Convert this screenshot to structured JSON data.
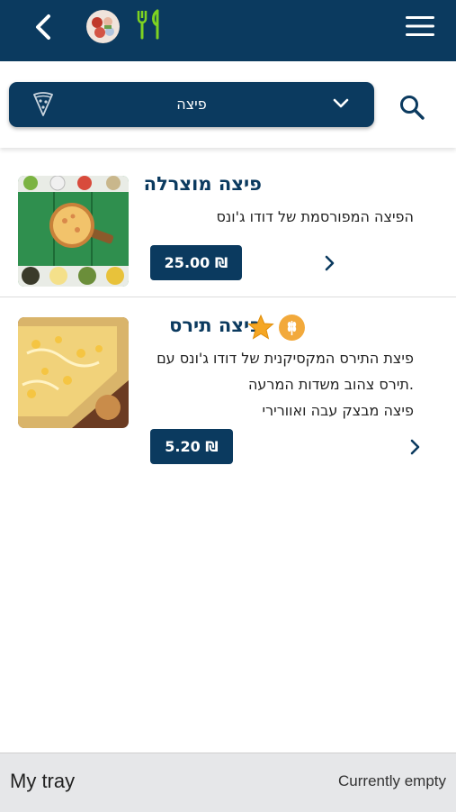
{
  "colors": {
    "brand": "#0b3a5f",
    "accent_green": "#7ed321",
    "badge_orange": "#f2a93b",
    "star": "#f5a623"
  },
  "header": {
    "back_icon": "chevron-left-icon",
    "logo": "restaurant-logo",
    "utensils_icon": "fork-knife-icon",
    "menu_icon": "hamburger-menu-icon"
  },
  "filter": {
    "selected_category": "פיצה",
    "category_icon": "pizza-slice-icon",
    "dropdown_icon": "chevron-down-icon",
    "search_icon": "search-icon"
  },
  "items": [
    {
      "name": "פיצה מוצרלה",
      "description_lines": [
        "הפיצה המפורסמת של דודו ג'ונס"
      ],
      "price": "25.00 ₪",
      "badges": []
    },
    {
      "name": "פיצה תירס",
      "description_lines": [
        "פיצת התירס המקסיקנית של דודו ג'ונס עם",
        ".תירס צהוב משדות המרעה",
        "פיצה מבצק עבה ואוורירי"
      ],
      "price": "5.20 ₪",
      "badges": [
        "star-icon",
        "wheat-icon"
      ]
    }
  ],
  "tray": {
    "title": "My tray",
    "status": "Currently empty"
  }
}
